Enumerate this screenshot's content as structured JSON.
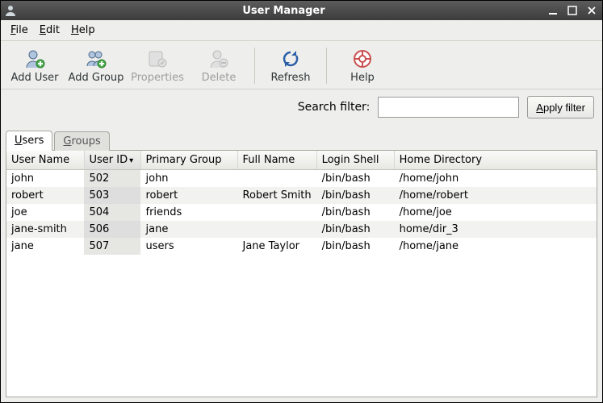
{
  "window": {
    "title": "User Manager"
  },
  "menubar": {
    "file": "File",
    "edit": "Edit",
    "help": "Help"
  },
  "toolbar": {
    "add_user": "Add User",
    "add_group": "Add Group",
    "properties": "Properties",
    "delete": "Delete",
    "refresh": "Refresh",
    "help": "Help"
  },
  "search": {
    "label": "Search filter:",
    "value": "",
    "apply": "Apply filter"
  },
  "tabs": {
    "users": "Users",
    "groups": "Groups",
    "active": "users"
  },
  "columns": {
    "username": "User Name",
    "userid": "User ID",
    "group": "Primary Group",
    "fullname": "Full Name",
    "shell": "Login Shell",
    "home": "Home Directory",
    "sort": "userid",
    "sort_dir": "desc"
  },
  "rows": [
    {
      "username": "john",
      "userid": "502",
      "group": "john",
      "fullname": "",
      "shell": "/bin/bash",
      "home": "/home/john"
    },
    {
      "username": "robert",
      "userid": "503",
      "group": "robert",
      "fullname": "Robert Smith",
      "shell": "/bin/bash",
      "home": "/home/robert"
    },
    {
      "username": "joe",
      "userid": "504",
      "group": "friends",
      "fullname": "",
      "shell": "/bin/bash",
      "home": "/home/joe"
    },
    {
      "username": "jane-smith",
      "userid": "506",
      "group": "jane",
      "fullname": "",
      "shell": "/bin/bash",
      "home": "home/dir_3"
    },
    {
      "username": "jane",
      "userid": "507",
      "group": "users",
      "fullname": "Jane Taylor",
      "shell": "/bin/bash",
      "home": "/home/jane"
    }
  ]
}
